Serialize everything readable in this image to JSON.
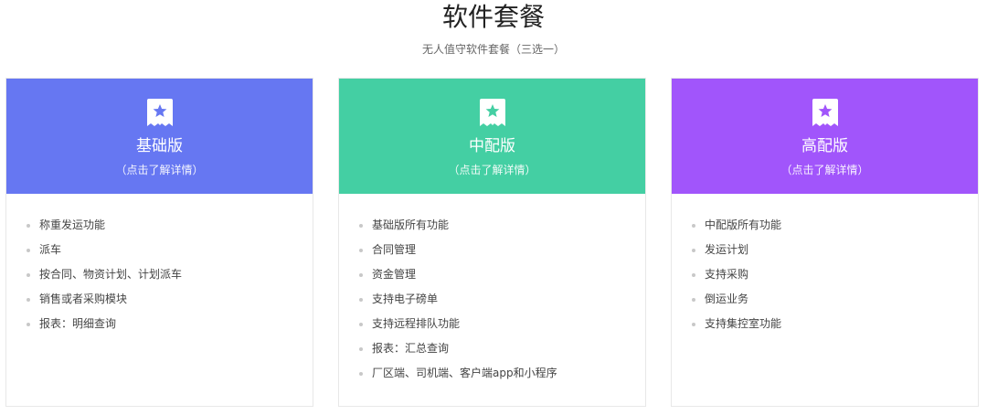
{
  "page": {
    "title": "软件套餐",
    "subtitle": "无人值守软件套餐（三选一）"
  },
  "plans": [
    {
      "name": "基础版",
      "sub": "（点击了解详情）",
      "color": "#6677f2",
      "icon": "star-badge-icon",
      "features": [
        "称重发运功能",
        "派车",
        "按合同、物资计划、计划派车",
        "销售或者采购模块",
        "报表：明细查询"
      ]
    },
    {
      "name": "中配版",
      "sub": "（点击了解详情）",
      "color": "#44cfa3",
      "icon": "star-badge-icon",
      "features": [
        "基础版所有功能",
        "合同管理",
        "资金管理",
        "支持电子磅单",
        "支持远程排队功能",
        "报表：汇总查询",
        "厂区端、司机端、客户端app和小程序"
      ]
    },
    {
      "name": "高配版",
      "sub": "（点击了解详情）",
      "color": "#a155fb",
      "icon": "star-badge-icon",
      "features": [
        "中配版所有功能",
        "发运计划",
        "支持采购",
        "倒运业务",
        "支持集控室功能"
      ]
    }
  ]
}
